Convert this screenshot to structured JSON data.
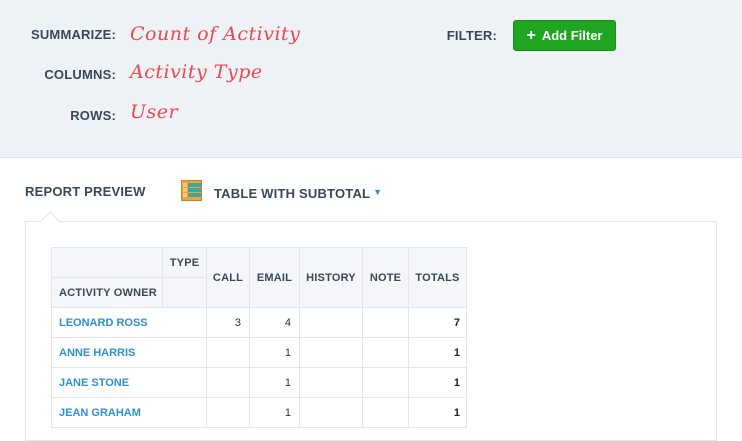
{
  "config": {
    "summarize_label": "SUMMARIZE:",
    "summarize_value": "Count of Activity",
    "columns_label": "COLUMNS:",
    "columns_value": "Activity Type",
    "rows_label": "ROWS:",
    "rows_value": "User",
    "filter_label": "FILTER:",
    "add_filter_label": "Add Filter"
  },
  "preview": {
    "label": "REPORT PREVIEW",
    "view_type": "TABLE WITH SUBTOTAL",
    "view_icon": "table-subtotal-icon"
  },
  "table": {
    "type_header": "TYPE",
    "owner_header": "ACTIVITY OWNER",
    "columns": [
      "CALL",
      "EMAIL",
      "HISTORY",
      "NOTE",
      "TOTALS"
    ],
    "rows": [
      {
        "owner": "LEONARD ROSS",
        "call": "3",
        "email": "4",
        "history": "",
        "note": "",
        "total": "7"
      },
      {
        "owner": "ANNE HARRIS",
        "call": "",
        "email": "1",
        "history": "",
        "note": "",
        "total": "1"
      },
      {
        "owner": "JANE STONE",
        "call": "",
        "email": "1",
        "history": "",
        "note": "",
        "total": "1"
      },
      {
        "owner": "JEAN GRAHAM",
        "call": "",
        "email": "1",
        "history": "",
        "note": "",
        "total": "1"
      }
    ]
  },
  "colors": {
    "accent_red": "#e8494d",
    "button_green": "#1fa51f",
    "link_blue": "#2f8fce",
    "header_bg": "#eef2f7"
  }
}
